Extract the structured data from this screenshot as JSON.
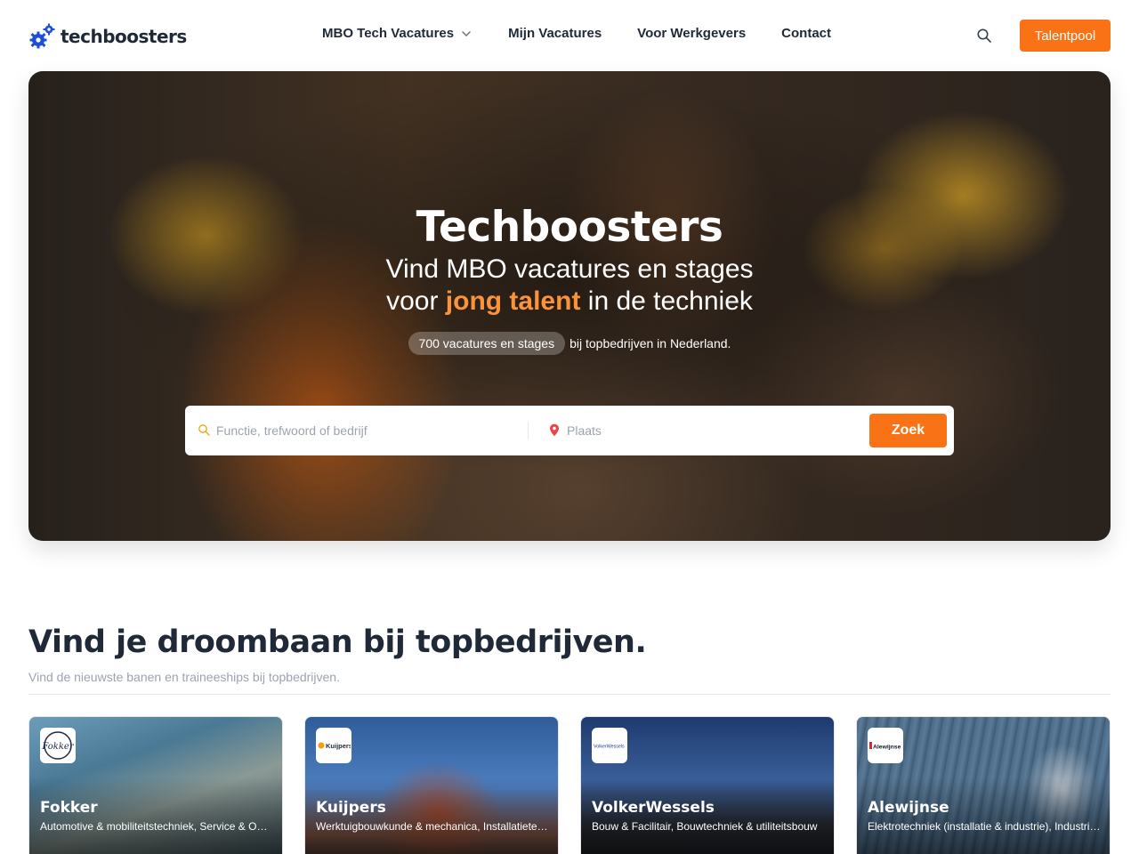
{
  "header": {
    "brand": "techboosters",
    "nav": [
      {
        "label": "MBO Tech Vacatures",
        "has_dropdown": true
      },
      {
        "label": "Mijn Vacatures"
      },
      {
        "label": "Voor Werkgevers"
      },
      {
        "label": "Contact"
      }
    ],
    "search_icon": "search-icon",
    "cta_label": "Talentpool"
  },
  "hero": {
    "title": "Techboosters",
    "subtitle_line1": "Vind MBO vacatures en stages",
    "subtitle_line2_pre": "voor ",
    "subtitle_line2_accent": "jong talent",
    "subtitle_line2_post": " in de techniek",
    "stats_pill": "700 vacatures en stages",
    "stats_text": "bij topbedrijven in Nederland.",
    "search": {
      "keyword_placeholder": "Functie, trefwoord of bedrijf",
      "place_placeholder": "Plaats",
      "button_label": "Zoek"
    }
  },
  "section": {
    "title": "Vind je droombaan bij topbedrijven.",
    "subtitle": "Vind de nieuwste banen en traineeships bij topbedrijven."
  },
  "companies": [
    {
      "name": "Fokker",
      "tags": "Automotive & mobiliteitstechniek, Service & Onderhoud",
      "logo_text": "Fokker"
    },
    {
      "name": "Kuijpers",
      "tags": "Werktuigbouwkunde & mechanica, Installatietechniek",
      "logo_text": "Kuijpers"
    },
    {
      "name": "VolkerWessels",
      "tags": "Bouw & Facilitair, Bouwtechniek & utiliteitsbouw",
      "logo_text": "VolkerWessels"
    },
    {
      "name": "Alewijnse",
      "tags": "Elektrotechniek (installatie & industrie), Industriële automatisering",
      "logo_text": "Alewijnse"
    }
  ],
  "colors": {
    "accent": "#f97316",
    "brand_blue": "#1d4ed8",
    "text": "#1f2937"
  }
}
